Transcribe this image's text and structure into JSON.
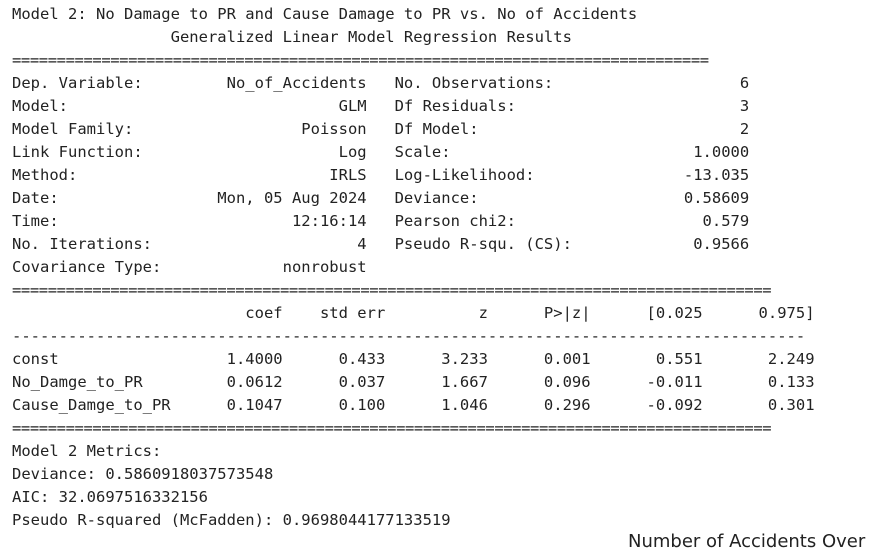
{
  "output": {
    "title_line": "Model 2: No Damage to PR and Cause Damage to PR vs. No of Accidents",
    "results_title": "                 Generalized Linear Model Regression Results",
    "rule_top": "==============================================================================",
    "info_rows": [
      "Dep. Variable:         No_of_Accidents   No. Observations:                    6",
      "Model:                             GLM   Df Residuals:                        3",
      "Model Family:                  Poisson   Df Model:                            2",
      "Link Function:                     Log   Scale:                          1.0000",
      "Method:                           IRLS   Log-Likelihood:                -13.035",
      "Date:                 Mon, 05 Aug 2024   Deviance:                      0.58609",
      "Time:                         12:16:14   Pearson chi2:                    0.579",
      "No. Iterations:                      4   Pseudo R-squ. (CS):             0.9566",
      "Covariance Type:             nonrobust"
    ],
    "rule_mid": "=====================================================================================",
    "coef_header": "                         coef    std err          z      P>|z|      [0.025      0.975]",
    "rule_dash": "-------------------------------------------------------------------------------------",
    "coef_rows": [
      "const                  1.4000      0.433      3.233      0.001       0.551       2.249",
      "No_Damge_to_PR         0.0612      0.037      1.667      0.096      -0.011       0.133",
      "Cause_Damge_to_PR      0.1047      0.100      1.046      0.296      -0.092       0.301"
    ],
    "rule_bottom": "=====================================================================================",
    "metrics": [
      "Model 2 Metrics:",
      "Deviance: 0.5860918037573548",
      "AIC: 32.0697516332156",
      "Pseudo R-squared (McFadden): 0.9698044177133519"
    ]
  },
  "next_chart_title_partial": "Number of Accidents Over"
}
